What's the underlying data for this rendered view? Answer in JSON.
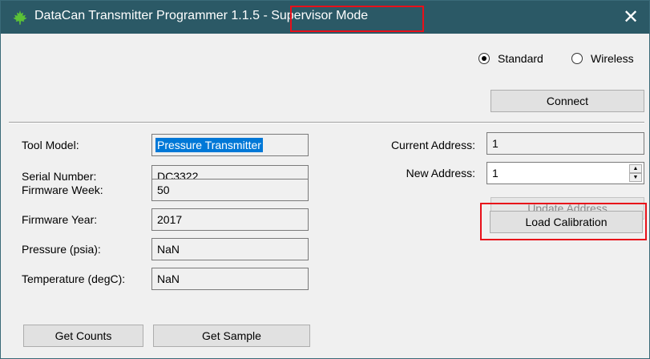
{
  "window": {
    "title_main": "DataCan Transmitter Programmer 1.1.5 ",
    "title_mode": "- Supervisor Mode",
    "close_glyph": "✕",
    "titlebar_color": "#2b5966"
  },
  "mode": {
    "standard_label": "Standard",
    "wireless_label": "Wireless",
    "selected": "Standard"
  },
  "connect_label": "Connect",
  "fields": {
    "tool_model_label": "Tool Model:",
    "tool_model_value": "Pressure Transmitter",
    "serial_label": "Serial Number:",
    "serial_value": "DC3322",
    "fw_week_label": "Firmware Week:",
    "fw_week_value": "50",
    "fw_year_label": "Firmware Year:",
    "fw_year_value": "2017",
    "pressure_label": "Pressure (psia):",
    "pressure_value": "NaN",
    "temp_label": "Temperature (degC):",
    "temp_value": "NaN"
  },
  "address": {
    "current_label": "Current Address:",
    "current_value": "1",
    "new_label": "New Address:",
    "new_value": "1",
    "update_label": "Update Address",
    "load_calibration_label": "Load Calibration"
  },
  "buttons": {
    "get_counts": "Get Counts",
    "get_sample": "Get Sample"
  },
  "icons": {
    "app": "maple-leaf-icon",
    "close": "close-icon"
  },
  "colors": {
    "highlight": "#e8101a",
    "selection": "#0078d7"
  }
}
